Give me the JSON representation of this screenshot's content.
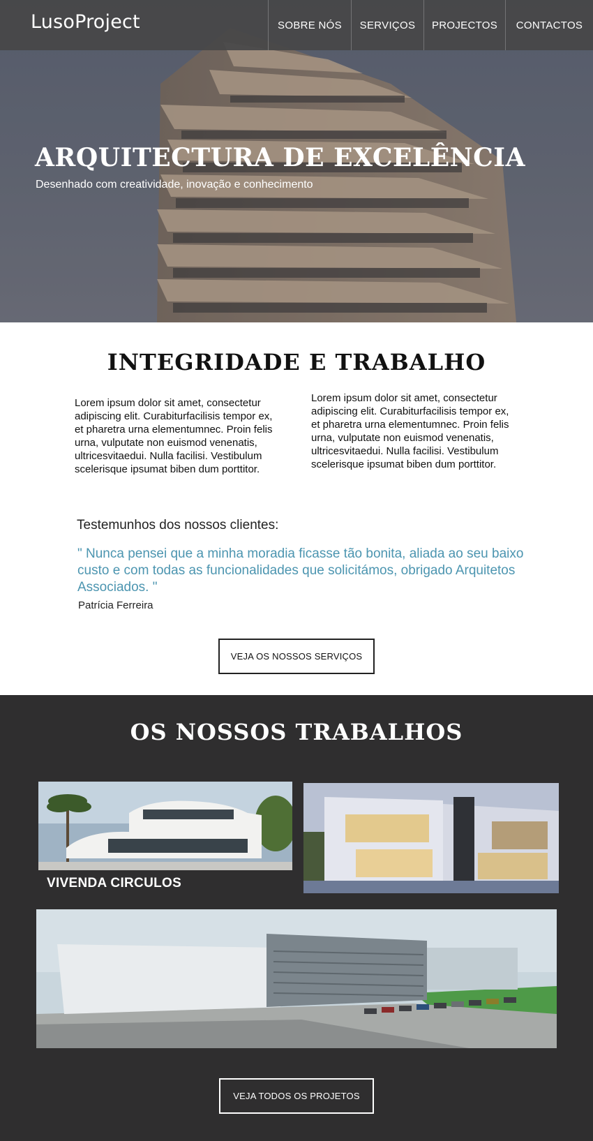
{
  "brand": "LusoProject",
  "nav": [
    {
      "label": "SOBRE NÓS"
    },
    {
      "label": "SERVIÇOS"
    },
    {
      "label": "PROJECTOS"
    },
    {
      "label": "CONTACTOS"
    }
  ],
  "hero": {
    "title": "ARQUITECTURA DE EXCELÊNCIA",
    "subtitle": "Desenhado com creatividade, inovação e conhecimento"
  },
  "intro": {
    "title": "INTEGRIDADE E TRABALHO",
    "col_left": "Lorem ipsum dolor sit amet, consectetur adipiscing elit. Curabiturfacilisis tempor ex, et pharetra urna elementumnec. Proin felis urna, vulputate non euismod venenatis, ultricesvitaedui. Nulla facilisi. Vestibulum scelerisque ipsumat biben dum porttitor.",
    "col_right": "Lorem ipsum dolor sit amet, consectetur adipiscing elit. Curabiturfacilisis tempor ex, et pharetra urna elementumnec. Proin felis urna, vulputate non euismod venenatis, ultricesvitaedui. Nulla facilisi. Vestibulum scelerisque ipsumat biben dum porttitor."
  },
  "testimonials": {
    "heading": "Testemunhos dos nossos clientes:",
    "quote": "\" Nunca pensei que a minha moradia ficasse tão bonita, aliada ao seu baixo custo e com todas as funcionalidades que solicitámos, obrigado Arquitetos Associados. \"",
    "author": "Patrícia Ferreira",
    "quote_color": "#4c95b0"
  },
  "services_button": "VEJA OS NOSSOS SERVIÇOS",
  "works": {
    "title": "OS NOSSOS TRABALHOS",
    "projects": [
      {
        "caption": "VIVENDA CIRCULOS"
      }
    ],
    "all_button": "VEJA TODOS OS PROJETOS",
    "background": "#2f2e2f"
  }
}
